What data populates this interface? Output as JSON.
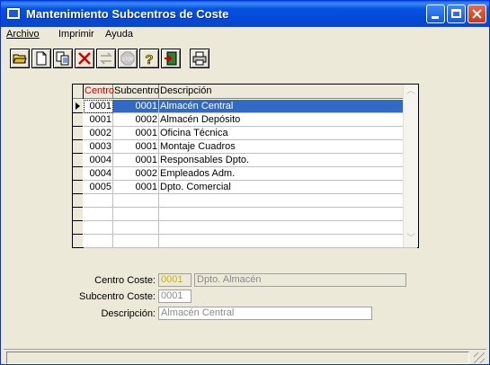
{
  "window": {
    "title": "Mantenimiento Subcentros de Coste"
  },
  "menu": [
    {
      "label": "Archivo"
    },
    {
      "label": "Imprimir"
    },
    {
      "label": "Ayuda"
    }
  ],
  "toolbar": [
    {
      "icon": "open-folder-icon"
    },
    {
      "icon": "new-document-icon"
    },
    {
      "icon": "copy-icon"
    },
    {
      "icon": "delete-x-icon"
    },
    {
      "icon": "swap-arrows-icon"
    },
    {
      "icon": "stop-icon"
    },
    {
      "icon": "help-icon"
    },
    {
      "icon": "exit-door-icon"
    },
    {
      "icon": "print-icon"
    }
  ],
  "grid": {
    "headers": [
      "Centro",
      "Subcentro",
      "Descripción"
    ],
    "rows": [
      {
        "centro": "0001",
        "subcentro": "0001",
        "descripcion": "Almacén Central",
        "selected": true
      },
      {
        "centro": "0001",
        "subcentro": "0002",
        "descripcion": "Almacén Depósito"
      },
      {
        "centro": "0002",
        "subcentro": "0001",
        "descripcion": "Oficina Técnica"
      },
      {
        "centro": "0003",
        "subcentro": "0001",
        "descripcion": "Montaje Cuadros"
      },
      {
        "centro": "0004",
        "subcentro": "0001",
        "descripcion": "Responsables Dpto."
      },
      {
        "centro": "0004",
        "subcentro": "0002",
        "descripcion": "Empleados Adm."
      },
      {
        "centro": "0005",
        "subcentro": "0001",
        "descripcion": "Dpto. Comercial"
      }
    ]
  },
  "form": {
    "centro_label": "Centro Coste:",
    "centro_code": "0001",
    "centro_desc": "Dpto. Almacén",
    "subcentro_label": "Subcentro Coste:",
    "subcentro_code": "0001",
    "descripcion_label": "Descripción:",
    "descripcion_value": "Almacén Central"
  },
  "colors": {
    "selection": "#316ac5",
    "header_highlight": "#d00000"
  }
}
